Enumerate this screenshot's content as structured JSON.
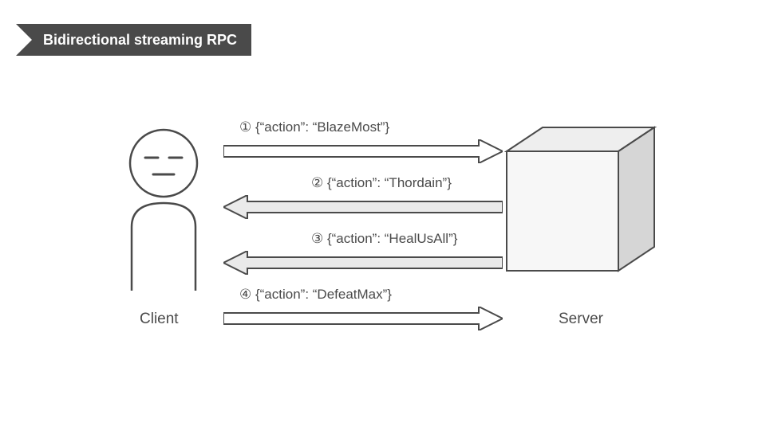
{
  "title": "Bidirectional streaming RPC",
  "client_label": "Client",
  "server_label": "Server",
  "messages": {
    "m1": "① {“action”: “BlazeMost”}",
    "m2": "② {“action”: “Thordain”}",
    "m3": "③ {“action”: “HealUsAll”}",
    "m4": "④ {“action”: “DefeatMax”}"
  },
  "chart_data": {
    "type": "sequence-diagram",
    "title": "Bidirectional streaming RPC",
    "participants": [
      "Client",
      "Server"
    ],
    "messages": [
      {
        "step": 1,
        "from": "Client",
        "to": "Server",
        "payload": {
          "action": "BlazeMost"
        }
      },
      {
        "step": 2,
        "from": "Server",
        "to": "Client",
        "payload": {
          "action": "Thordain"
        }
      },
      {
        "step": 3,
        "from": "Server",
        "to": "Client",
        "payload": {
          "action": "HealUsAll"
        }
      },
      {
        "step": 4,
        "from": "Client",
        "to": "Server",
        "payload": {
          "action": "DefeatMax"
        }
      }
    ]
  }
}
